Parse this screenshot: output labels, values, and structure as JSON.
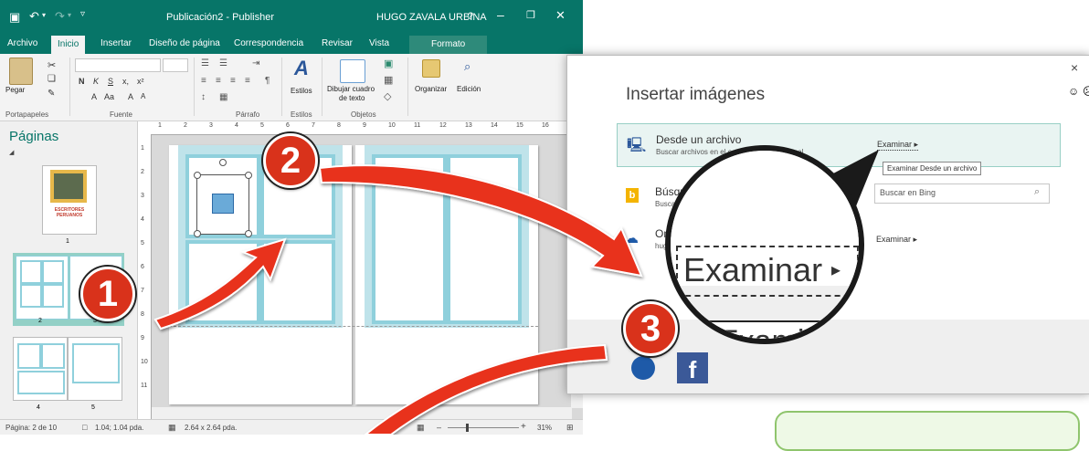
{
  "window": {
    "title": "Publicación2 - Publisher",
    "user": "HUGO ZAVALA URBINA",
    "help": "?"
  },
  "tabs": [
    "Archivo",
    "Inicio",
    "Insertar",
    "Diseño de página",
    "Correspondencia",
    "Revisar",
    "Vista",
    "Formato"
  ],
  "ribbon": {
    "paste_label": "Pegar",
    "styles_label": "Estilos",
    "textbox_label_1": "Dibujar cuadro",
    "textbox_label_2": "de texto",
    "arrange_label": "Organizar",
    "edit_label": "Edición",
    "groups": [
      "Portapapeles",
      "Fuente",
      "Párrafo",
      "Estilos",
      "Objetos"
    ],
    "font_buttons": [
      "N",
      "K",
      "S",
      "x,",
      "x²",
      "A",
      "Aa",
      "A",
      "A"
    ]
  },
  "pages_pane": {
    "title": "Páginas",
    "thumb1_label": "ESCRITORES PERUANOS",
    "page_numbers": [
      "1",
      "2",
      "3",
      "4",
      "5"
    ]
  },
  "ruler": {
    "marks": [
      "1",
      "2",
      "3",
      "4",
      "5",
      "6",
      "7",
      "8",
      "9",
      "10",
      "11",
      "12",
      "13",
      "14",
      "15",
      "16"
    ],
    "vmarks": [
      "1",
      "2",
      "3",
      "4",
      "5",
      "6",
      "7",
      "8",
      "9",
      "10",
      "11"
    ]
  },
  "status": {
    "page": "Página: 2 de 10",
    "position": "1.04; 1.04 pda.",
    "size": "2.64 x 2.64 pda.",
    "zoom": "31%"
  },
  "dialog": {
    "title": "Insertar imágenes",
    "close": "×",
    "option1_title": "Desde un archivo",
    "option1_sub": "Buscar archivos en el equipo o en la red local",
    "browse_label": "Examinar ▸",
    "tooltip": "Examinar Desde un archivo",
    "option2_title": "Búsqueda de im",
    "option2_sub": "Buscar en la",
    "bing_placeholder": "Buscar en Bing",
    "option3_title": "One",
    "option3_sub": "hug",
    "browse2_label": "Examinar ▸"
  },
  "magnifier": {
    "text": "Examinar",
    "bottom_text": "Exami"
  },
  "callouts": [
    "1",
    "2",
    "3"
  ],
  "colors": {
    "publisher_green": "#077568",
    "callout_red": "#d9321b",
    "arrow_red": "#e8301f",
    "layout_teal": "#8fd0dc"
  }
}
